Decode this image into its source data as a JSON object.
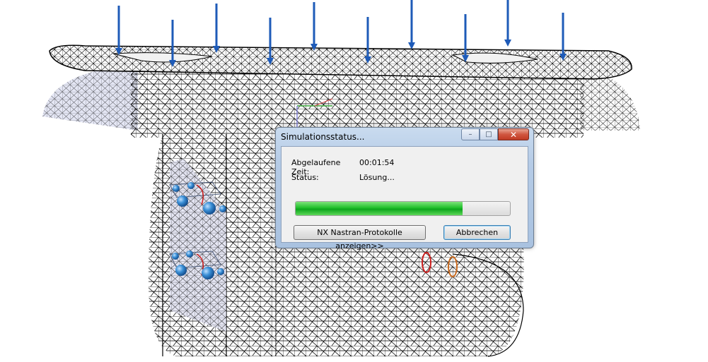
{
  "dialog": {
    "title": "Simulationsstatus...",
    "elapsed_label": "Abgelaufene Zeit:",
    "elapsed_value": "00:01:54",
    "status_label": "Status:",
    "status_value": "Lösung...",
    "progress_fraction": 0.78,
    "log_button_label": "NX Nastran-Protokolle anzeigen>>",
    "cancel_button_label": "Abbrechen",
    "minimize_glyph": "–",
    "maximize_glyph": "□",
    "close_glyph": "✕"
  },
  "colors": {
    "load_arrow": "#1e5bb8",
    "constraint_sphere": "#3a8fd6",
    "mesh_line": "#000000",
    "shaded_face": "#e4e6f4",
    "progress_fill": "#16b526"
  },
  "viewport": {
    "load_arrow_count": 10,
    "icons": [
      "load-arrow-icon",
      "constraint-sphere-icon",
      "coordinate-axes-icon"
    ]
  }
}
